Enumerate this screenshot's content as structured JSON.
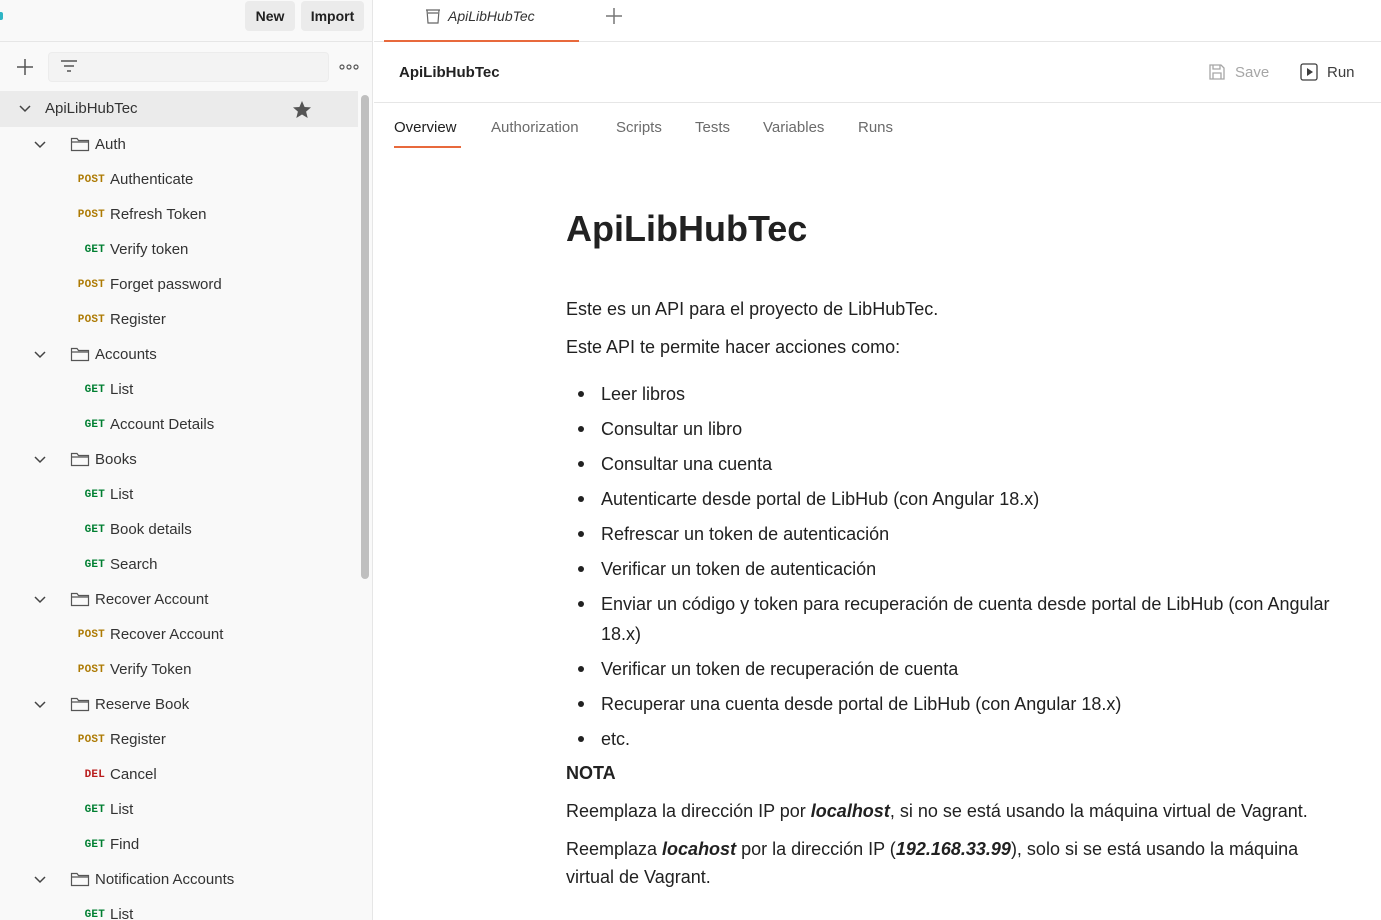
{
  "sidebar": {
    "new_label": "New",
    "import_label": "Import",
    "tree": [
      {
        "kind": "collection",
        "label": "ApiLibHubTec"
      },
      {
        "kind": "folder",
        "label": "Auth"
      },
      {
        "kind": "request",
        "method": "POST",
        "label": "Authenticate"
      },
      {
        "kind": "request",
        "method": "POST",
        "label": "Refresh Token"
      },
      {
        "kind": "request",
        "method": "GET",
        "label": "Verify token"
      },
      {
        "kind": "request",
        "method": "POST",
        "label": "Forget password"
      },
      {
        "kind": "request",
        "method": "POST",
        "label": "Register"
      },
      {
        "kind": "folder",
        "label": "Accounts"
      },
      {
        "kind": "request",
        "method": "GET",
        "label": "List"
      },
      {
        "kind": "request",
        "method": "GET",
        "label": "Account Details"
      },
      {
        "kind": "folder",
        "label": "Books"
      },
      {
        "kind": "request",
        "method": "GET",
        "label": "List"
      },
      {
        "kind": "request",
        "method": "GET",
        "label": "Book details"
      },
      {
        "kind": "request",
        "method": "GET",
        "label": "Search"
      },
      {
        "kind": "folder",
        "label": "Recover Account"
      },
      {
        "kind": "request",
        "method": "POST",
        "label": "Recover Account"
      },
      {
        "kind": "request",
        "method": "POST",
        "label": "Verify Token"
      },
      {
        "kind": "folder",
        "label": "Reserve Book"
      },
      {
        "kind": "request",
        "method": "POST",
        "label": "Register"
      },
      {
        "kind": "request",
        "method": "DEL",
        "label": "Cancel"
      },
      {
        "kind": "request",
        "method": "GET",
        "label": "List"
      },
      {
        "kind": "request",
        "method": "GET",
        "label": "Find"
      },
      {
        "kind": "folder",
        "label": "Notification Accounts"
      },
      {
        "kind": "request",
        "method": "GET",
        "label": "List"
      }
    ]
  },
  "tabbar": {
    "tab_label": "ApiLibHubTec"
  },
  "header": {
    "title": "ApiLibHubTec",
    "save_label": "Save",
    "run_label": "Run"
  },
  "subtabs": [
    "Overview",
    "Authorization",
    "Scripts",
    "Tests",
    "Variables",
    "Runs"
  ],
  "doc": {
    "title": "ApiLibHubTec",
    "intro1": "Este es un API para el proyecto de LibHubTec.",
    "intro2": "Este API te permite hacer acciones como:",
    "bullets": [
      "Leer libros",
      "Consultar un libro",
      "Consultar una cuenta",
      "Autenticarte desde portal de LibHub (con Angular 18.x)",
      "Refrescar un token de autenticación",
      "Verificar un token de autenticación",
      "Enviar un código y token para recuperación de cuenta desde portal de LibHub (con Angular 18.x)",
      "Verificar un token de recuperación de cuenta",
      "Recuperar una cuenta desde portal de LibHub (con Angular 18.x)",
      "etc."
    ],
    "note_heading": "NOTA",
    "note1": {
      "pre": "Reemplaza la dirección IP por ",
      "em": "localhost",
      "post": ", si no se está usando la máquina virtual de Vagrant."
    },
    "note2": {
      "pre": "Reemplaza ",
      "em1": "locahost",
      "mid": " por la dirección IP (",
      "em2": "192.168.33.99",
      "post": "), solo si se está usando la máquina virtual de Vagrant."
    }
  },
  "colors": {
    "accent": "#e8693c",
    "post": "#ad7a03",
    "get": "#007f31",
    "del": "#b91c1c"
  }
}
